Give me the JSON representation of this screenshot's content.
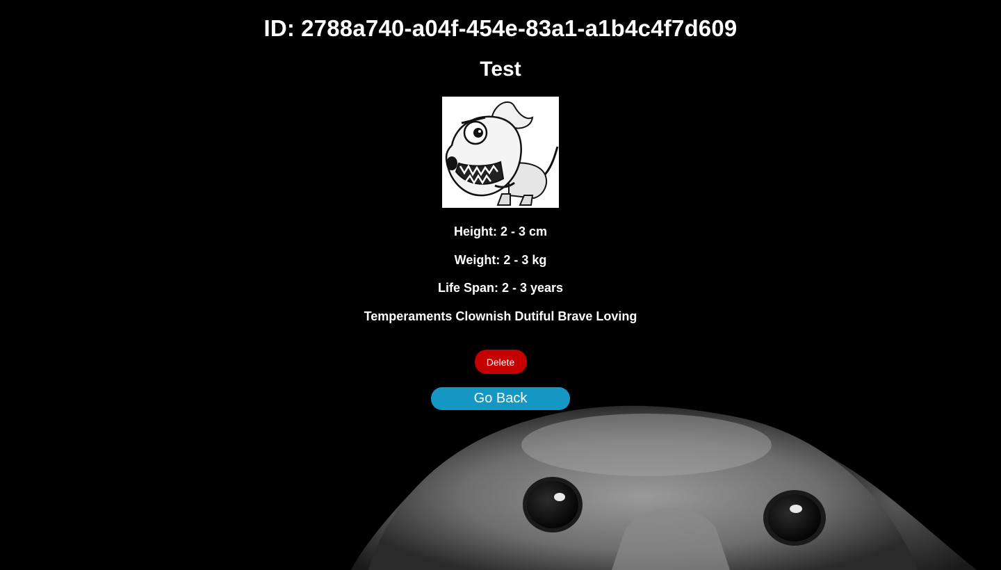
{
  "detail": {
    "id_label": "ID:",
    "id_value": "2788a740-a04f-454e-83a1-a1b4c4f7d609",
    "name": "Test",
    "height_label": "Height:",
    "height_value": "2 - 3 cm",
    "weight_label": "Weight:",
    "weight_value": "2 - 3 kg",
    "life_span_label": "Life Span:",
    "life_span_value": "2 - 3 years",
    "temperaments_label": "Temperaments",
    "temperaments_value": "Clownish Dutiful Brave Loving",
    "image_alt": "cartoon dog sketch"
  },
  "actions": {
    "delete_label": "Delete",
    "back_label": "Go Back"
  },
  "colors": {
    "background": "#000000",
    "delete_button": "#c40000",
    "back_button": "#1597c4",
    "text": "#ffffff"
  },
  "icons": {
    "breed_image": "cartoon-dog-sketch-icon",
    "background": "dachshund-puppy-photo"
  }
}
